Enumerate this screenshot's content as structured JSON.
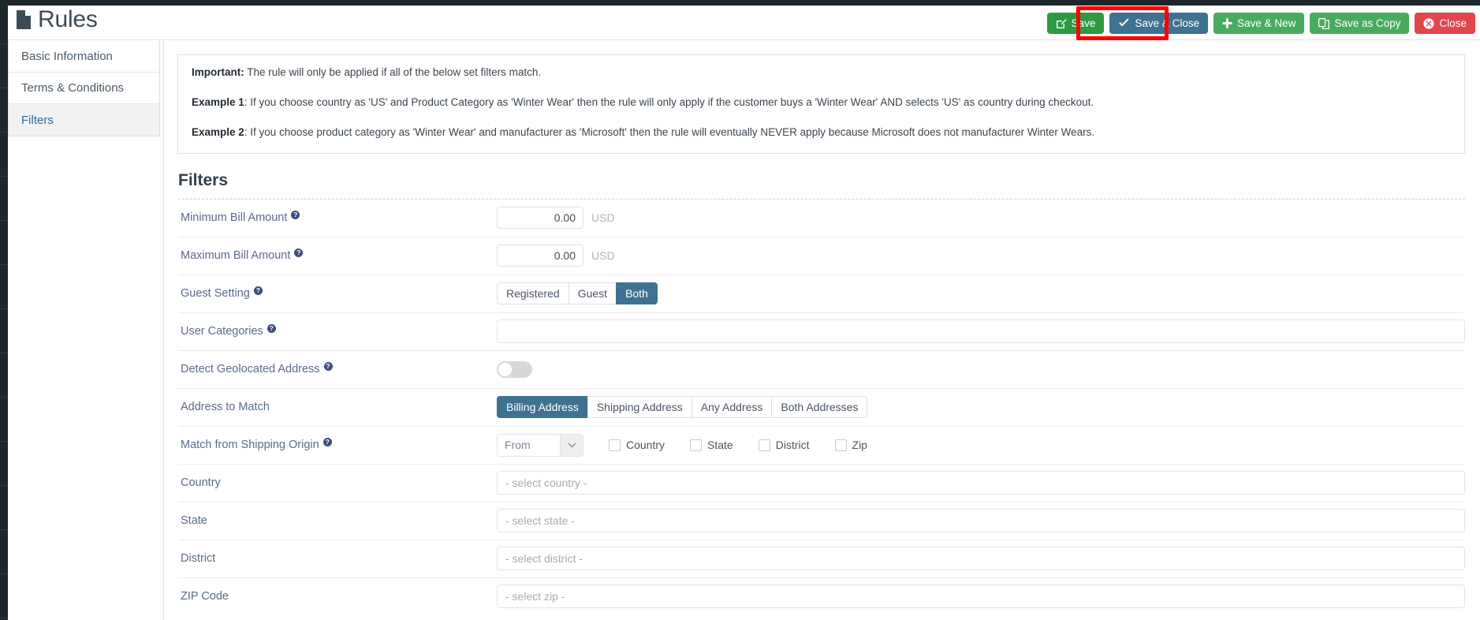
{
  "header": {
    "title": "Rules",
    "title_icon": "document-icon"
  },
  "toolbar": {
    "buttons": [
      {
        "label": "Save",
        "icon": "edit-square-icon",
        "style": "green",
        "highlighted": true
      },
      {
        "label": "Save & Close",
        "icon": "check-icon",
        "style": "slate",
        "highlighted": false
      },
      {
        "label": "Save & New",
        "icon": "plus-icon",
        "style": "green2",
        "highlighted": false
      },
      {
        "label": "Save as Copy",
        "icon": "copy-icon",
        "style": "green2",
        "highlighted": false
      },
      {
        "label": "Close",
        "icon": "close-circle-icon",
        "style": "red",
        "highlighted": false
      }
    ],
    "highlight_color": "#ff0000"
  },
  "sidebar": {
    "items": [
      {
        "label": "Basic Information",
        "active": false
      },
      {
        "label": "Terms & Conditions",
        "active": false
      },
      {
        "label": "Filters",
        "active": true
      }
    ]
  },
  "info_box": {
    "lines": [
      {
        "bold": "Important:",
        "text": " The rule will only be applied if all of the below set filters match."
      },
      {
        "bold": "Example 1",
        "text": ": If you choose country as 'US' and Product Category as 'Winter Wear' then the rule will only apply if the customer buys a 'Winter Wear' AND selects 'US' as country during checkout."
      },
      {
        "bold": "Example 2",
        "text": ": If you choose product category as 'Winter Wear' and manufacturer as 'Microsoft' then the rule will eventually NEVER apply because Microsoft does not manufacturer Winter Wears."
      }
    ]
  },
  "main": {
    "section_title": "Filters",
    "rows": {
      "minimum_bill_amount": {
        "label": "Minimum Bill Amount",
        "help": "?",
        "value": "0.00",
        "unit": "USD"
      },
      "maximum_bill_amount": {
        "label": "Maximum Bill Amount",
        "help": "?",
        "value": "0.00",
        "unit": "USD"
      },
      "guest_setting": {
        "label": "Guest Setting",
        "help": "?",
        "options": [
          {
            "label": "Registered",
            "selected": false
          },
          {
            "label": "Guest",
            "selected": false
          },
          {
            "label": "Both",
            "selected": true
          }
        ]
      },
      "user_categories": {
        "label": "User Categories",
        "help": "?",
        "value": "",
        "placeholder": ""
      },
      "detect_geolocated_address": {
        "label": "Detect Geolocated Address",
        "help": "?",
        "toggle_on": false
      },
      "address_to_match": {
        "label": "Address to Match",
        "options": [
          {
            "label": "Billing Address",
            "selected": true
          },
          {
            "label": "Shipping Address",
            "selected": false
          },
          {
            "label": "Any Address",
            "selected": false
          },
          {
            "label": "Both Addresses",
            "selected": false
          }
        ]
      },
      "match_from_shipping_origin": {
        "label": "Match from Shipping Origin",
        "help": "?",
        "select_value": "From",
        "checkboxes": [
          {
            "label": "Country",
            "checked": false
          },
          {
            "label": "State",
            "checked": false
          },
          {
            "label": "District",
            "checked": false
          },
          {
            "label": "Zip",
            "checked": false
          }
        ]
      },
      "country": {
        "label": "Country",
        "placeholder": "- select country -",
        "value": ""
      },
      "state": {
        "label": "State",
        "placeholder": "- select state -",
        "value": ""
      },
      "district": {
        "label": "District",
        "placeholder": "- select district -",
        "value": ""
      },
      "zip_code": {
        "label": "ZIP Code",
        "placeholder": "- select zip -",
        "value": ""
      }
    }
  },
  "colors": {
    "accent_selected": "#3e7290",
    "save_green": "#2d9a41",
    "button_green": "#49ab5f",
    "close_red": "#e0464c",
    "rail_dark": "#1e272c",
    "label_blue": "#5b6b8a"
  }
}
